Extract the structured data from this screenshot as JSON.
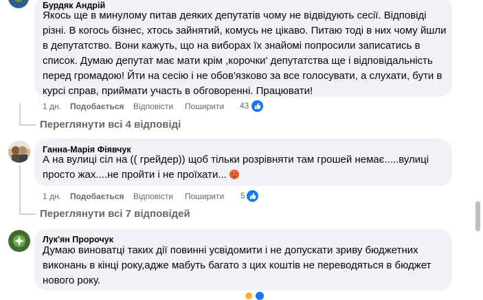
{
  "comments": [
    {
      "author": "Бурдяк Андрій",
      "lines": [
        "Якось ще в минулому питав деяких депутатів чому не відвідують сесії. Відповіді",
        "різні. В когось бізнес, хтось зайнятий, комусь не цікаво. Питаю тоді в них чому йшли",
        "в депутатство. Вони кажуть, що на виборах їх знайомі попросили записатись в",
        "список. Думаю депутат має мати крім ,корочки' депутатства ще і відповідальність",
        "перед громадою! Йти на сесію і не обов'язково за все голосувати, а слухати, бути в",
        "курсі справ, приймати участь в обговоренні. Працювати!"
      ],
      "time": "1 дн.",
      "like_label": "Подобається",
      "reply_label": "Відповісти",
      "share_label": "Поширити",
      "reaction_count": "43",
      "view_replies": "Переглянути всі 4 відповіді"
    },
    {
      "author": "Ганна-Марія Фіявчук",
      "lines": [
        "А на вулиці сіл на (( грейдер)) щоб тільки розрівняти там грошей немає.....вулиці",
        "просто жах....не пройти і не проїхати..."
      ],
      "time": "1 дн.",
      "like_label": "Подобається",
      "reply_label": "Відповісти",
      "share_label": "Поширити",
      "reaction_count": "5",
      "view_replies": "Переглянути всі 7 відповідей"
    },
    {
      "author": "Лук'ян Пророчук",
      "lines": [
        "Думаю виноватці таких дії повинні усвідомити і не допускати зриву бюджетних",
        "виконань в кінці року,адже мабуть багато з цих коштів не переводяться в бюджет",
        "нового року."
      ]
    }
  ],
  "icons": {
    "like_reaction": "thumbs-up-icon",
    "angry_emoji": "angry-face-icon"
  },
  "colors": {
    "bubble": "#f0f2f5",
    "muted_text": "#65676b",
    "like_blue": "#1877f2"
  }
}
